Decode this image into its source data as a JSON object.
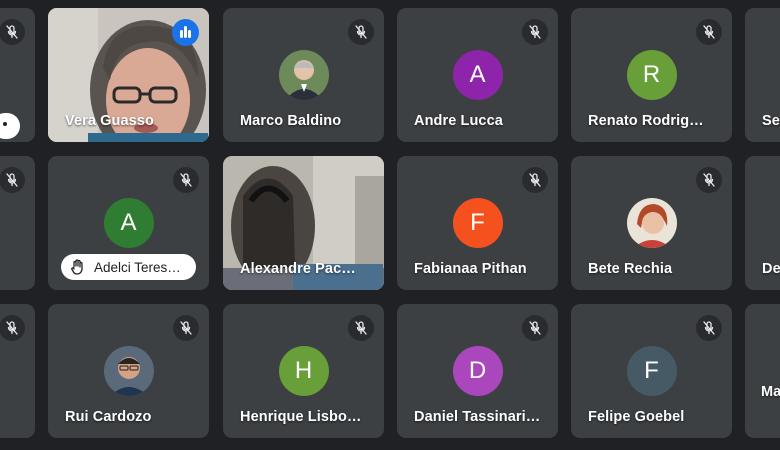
{
  "participants": {
    "vera": {
      "name": "Vera Guasso"
    },
    "marco": {
      "name": "Marco Baldino"
    },
    "andre": {
      "name": "Andre Lucca",
      "initial": "A"
    },
    "renato": {
      "name": "Renato Rodrig…",
      "initial": "R"
    },
    "se": {
      "name": "Se"
    },
    "adelci": {
      "name": "Adelci Teres…",
      "initial": "A"
    },
    "alexandre": {
      "name": "Alexandre Pac…"
    },
    "fabianaa": {
      "name": "Fabianaa Pithan",
      "initial": "F"
    },
    "bete": {
      "name": "Bete Rechia"
    },
    "de": {
      "name": "De"
    },
    "rui": {
      "name": "Rui Cardozo"
    },
    "henrique": {
      "name": "Henrique Lisbo…",
      "initial": "H"
    },
    "daniel": {
      "name": "Daniel Tassinari…",
      "initial": "D"
    },
    "felipe": {
      "name": "Felipe Goebel",
      "initial": "F"
    },
    "ma": {
      "name": "Ma"
    }
  },
  "colors": {
    "background": "#202124",
    "tile": "#3c4043",
    "speaking_border": "#8ab4f8",
    "avatar_purple": "#8e24aa",
    "avatar_green": "#689f38",
    "avatar_dark_green": "#2e7d32",
    "avatar_orange": "#f4511e",
    "avatar_violet": "#ab47bc",
    "avatar_slate": "#455a64",
    "speaking_indicator": "#1a73e8"
  },
  "icons": {
    "muted": "mic-off-icon",
    "speaking": "audio-level-icon",
    "hand": "raised-hand-icon"
  }
}
